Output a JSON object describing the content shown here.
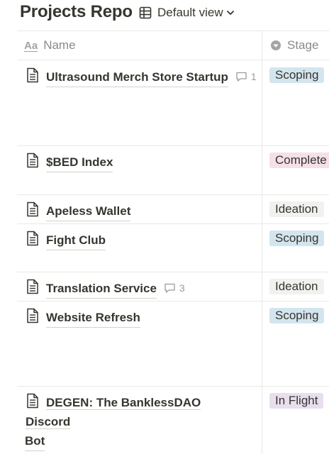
{
  "header": {
    "title": "Projects Repo",
    "view_label": "Default view",
    "view_icon": "table-icon",
    "view_chevron_icon": "chevron-down-icon"
  },
  "columns": {
    "name": {
      "label": "Name",
      "icon": "text-property-icon",
      "icon_text": "Aa"
    },
    "stage": {
      "label": "Stage",
      "icon": "select-property-icon"
    }
  },
  "rows": [
    {
      "title": "Ultrasound Merch Store Startup",
      "comments": "1",
      "stage": "Scoping"
    },
    {
      "title": "$BED Index",
      "stage": "Complete"
    },
    {
      "title": "Apeless Wallet",
      "stage": "Ideation"
    },
    {
      "title": "Fight Club",
      "stage": "Scoping"
    },
    {
      "title": "Translation Service",
      "comments": "3",
      "stage": "Ideation"
    },
    {
      "title": "Website Refresh",
      "stage": "Scoping"
    },
    {
      "title_line1": "DEGEN: The BanklessDAO Discord",
      "title_line2": "Bot",
      "stage": "In Flight"
    }
  ],
  "stage_colors": {
    "Scoping": "#d3e5ef",
    "Complete": "#f5e0e9",
    "Ideation": "#f1f1ef",
    "In Flight": "#e8deee"
  }
}
